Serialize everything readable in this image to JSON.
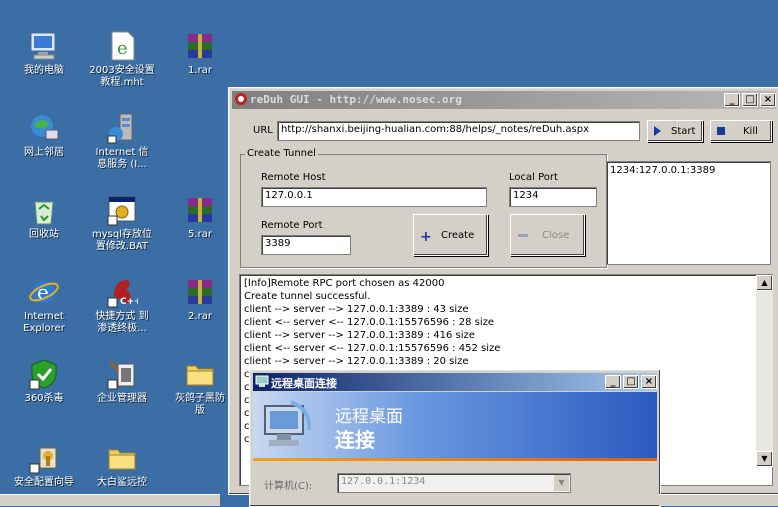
{
  "desktop": {
    "icons": [
      {
        "label": "我的电脑",
        "icon": "my-computer-icon"
      },
      {
        "label": "2003安全设置\n教程.mht",
        "icon": "mht-file-icon"
      },
      {
        "label": "1.rar",
        "icon": "rar-archive-icon"
      },
      {
        "label": "网上邻居",
        "icon": "network-places-icon"
      },
      {
        "label": "Internet 信\n息服务 (I...",
        "icon": "iis-icon"
      },
      {
        "label": "回收站",
        "icon": "recycle-bin-icon"
      },
      {
        "label": "mysql存放位\n置修改.BAT",
        "icon": "bat-file-icon"
      },
      {
        "label": "5.rar",
        "icon": "rar-archive-icon"
      },
      {
        "label": "Internet\nExplorer",
        "icon": "internet-explorer-icon"
      },
      {
        "label": "快捷方式 到\n渗透终极...",
        "icon": "cpp-shortcut-icon"
      },
      {
        "label": "2.rar",
        "icon": "rar-archive-icon"
      },
      {
        "label": "360杀毒",
        "icon": "360-antivirus-icon"
      },
      {
        "label": "企业管理器",
        "icon": "enterprise-manager-icon"
      },
      {
        "label": "灰鸽子黑防\n版",
        "icon": "folder-icon"
      },
      {
        "label": "安全配置向导",
        "icon": "security-wizard-icon"
      },
      {
        "label": "大白鲨远控",
        "icon": "folder-icon"
      }
    ]
  },
  "reduh": {
    "title": "reDuh GUI - http://www.nosec.org",
    "url_label": "URL",
    "url_value": "http://shanxi.beijing-hualian.com:88/helps/_notes/reDuh.aspx",
    "start_label": "Start",
    "kill_label": "Kill",
    "tunnel_group": "Create Tunnel",
    "remote_host_label": "Remote Host",
    "remote_host_value": "127.0.0.1",
    "local_port_label": "Local Port",
    "local_port_value": "1234",
    "remote_port_label": "Remote Port",
    "remote_port_value": "3389",
    "create_label": "Create",
    "close_label": "Close",
    "tunnels": [
      "1234:127.0.0.1:3389"
    ],
    "log": [
      "[Info]Remote RPC port chosen as 42000",
      "Create tunnel successful.",
      "client --> server --> 127.0.0.1:3389 : 43 size",
      "client <-- server <-- 127.0.0.1:15576596 : 28 size",
      "client --> server --> 127.0.0.1:3389 : 416 size",
      "client <-- server <-- 127.0.0.1:15576596 : 452 size",
      "client --> server --> 127.0.0.1:3389 : 20 size",
      "cl",
      "cl",
      "cl",
      "cl",
      "cl",
      "cl"
    ]
  },
  "rdp": {
    "title": "远程桌面连接",
    "banner_line1": "远程桌面",
    "banner_line2": "连接",
    "computer_label": "计算机(C):",
    "computer_value": "127.0.0.1:1234"
  },
  "colors": {
    "desktop": "#3a6ea5",
    "active_title_start": "#0a246a",
    "active_title_end": "#a6caf0",
    "inactive_title_start": "#7f7f7f",
    "dialog_face": "#d4d0c8",
    "rdp_banner": "#2a5bc0"
  }
}
